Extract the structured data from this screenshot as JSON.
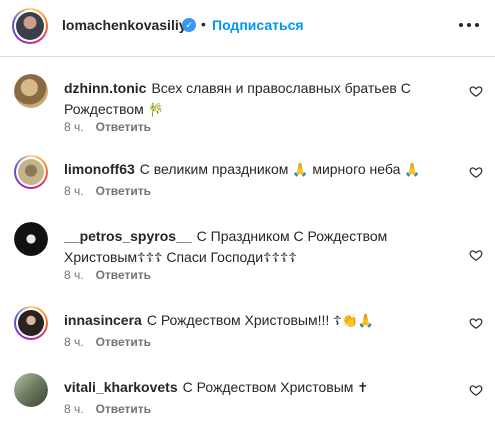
{
  "header": {
    "username": "lomachenkovasiliy",
    "verified_icon": "verified-check-icon",
    "separator": "•",
    "follow_label": "Подписаться",
    "more_icon": "more-horizontal-icon"
  },
  "comments": [
    {
      "username": "dzhinn.tonic",
      "text": "Всех славян и православных братьев С Рождеством",
      "emoji": "🎋",
      "time": "8 ч.",
      "reply_label": "Ответить"
    },
    {
      "username": "limonoff63",
      "text": "С великим праздником",
      "emoji": "🙏",
      "text2": "мирного неба",
      "emoji2": "🙏",
      "time": "8 ч.",
      "reply_label": "Ответить"
    },
    {
      "username": "__petros_spyros__",
      "text": "С Праздником С Рождеством Христовым",
      "emoji": "☦☦☦",
      "text2": "Спаси Господи",
      "emoji2": "☦☦☦☦",
      "time": "8 ч.",
      "reply_label": "Ответить"
    },
    {
      "username": "innasincera",
      "text": "С Рождеством Христовым!!!",
      "emoji": "☦👏🙏",
      "time": "8 ч.",
      "reply_label": "Ответить"
    },
    {
      "username": "vitali_kharkovets",
      "text": "С Рождеством Христовым",
      "emoji": "✝",
      "time": "8 ч.",
      "reply_label": "Ответить"
    }
  ],
  "icons": {
    "like": "heart-outline-icon"
  },
  "colors": {
    "follow": "#0095f6",
    "verified": "#3897f0",
    "meta": "#737373"
  }
}
